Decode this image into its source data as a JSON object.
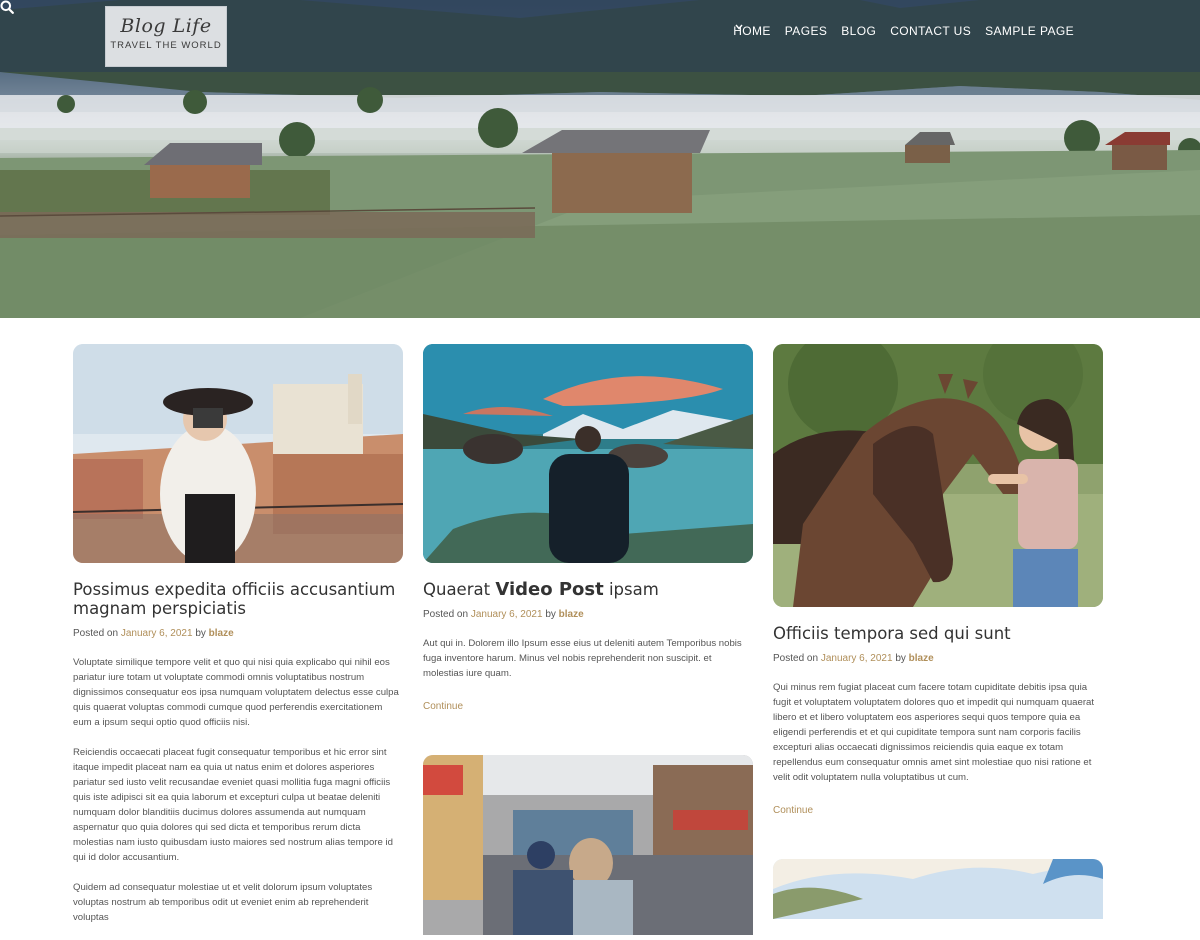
{
  "site": {
    "title": "Blog Life",
    "tagline": "TRAVEL THE WORLD"
  },
  "nav": {
    "items": [
      "HOME",
      "PAGES",
      "BLOG",
      "CONTACT US",
      "SAMPLE PAGE"
    ],
    "search_icon": "search-icon"
  },
  "colors": {
    "accent": "#b08f5a",
    "header_bar": "rgba(40,60,85,0.55)"
  },
  "posts": [
    {
      "title": "Possimus expedita officiis accusantium magnam perspiciatis",
      "posted_on": "Posted on",
      "date": "January 6, 2021",
      "by": "by",
      "author": "blaze",
      "paragraphs": [
        "Voluptate similique tempore velit et quo qui nisi quia explicabo qui nihil eos pariatur iure totam ut voluptate commodi omnis voluptatibus nostrum dignissimos consequatur eos ipsa numquam voluptatem delectus esse culpa quis quaerat voluptas commodi cumque quod perferendis exercitationem eum a ipsum sequi optio quod officiis nisi.",
        "Reiciendis occaecati placeat fugit consequatur temporibus et hic error sint itaque impedit placeat nam ea quia ut natus enim et dolores asperiores pariatur sed iusto velit recusandae eveniet quasi mollitia fuga magni officiis quis iste adipisci sit ea quia laborum et excepturi culpa ut beatae deleniti numquam dolor blanditiis ducimus dolores assumenda aut numquam aspernatur quo quia dolores qui sed dicta et temporibus rerum dicta molestias nam iusto quibusdam iusto maiores sed nostrum alias tempore id qui id dolor accusantium.",
        "Quidem ad consequatur molestiae ut et velit dolorum ipsum voluptates voluptas nostrum ab temporibus odit ut eveniet enim ab reprehenderit voluptas"
      ]
    },
    {
      "title_prefix": "Quaerat",
      "title_bold": "Video Post",
      "title_suffix": "ipsam",
      "posted_on": "Posted on",
      "date": "January 6, 2021",
      "by": "by",
      "author": "blaze",
      "excerpt": "Aut qui in. Dolorem illo Ipsum esse eius ut deleniti autem Temporibus nobis fuga inventore harum. Minus vel nobis reprehenderit non suscipit. et molestias iure quam.",
      "continue": "Continue"
    },
    {
      "title": "Officiis tempora sed qui sunt",
      "posted_on": "Posted on",
      "date": "January 6, 2021",
      "by": "by",
      "author": "blaze",
      "excerpt": "Qui minus rem fugiat placeat cum facere totam cupiditate debitis ipsa quia fugit et voluptatem voluptatem dolores quo et impedit qui numquam quaerat libero et et libero voluptatem eos asperiores sequi quos tempore quia ea eligendi perferendis et et qui cupiditate tempora sunt nam corporis facilis excepturi alias occaecati dignissimos reiciendis quia eaque ex totam repellendus eum consequatur omnis amet sint molestiae quo nisi ratione et velit odit voluptatem nulla voluptatibus ut cum.",
      "continue": "Continue"
    }
  ]
}
